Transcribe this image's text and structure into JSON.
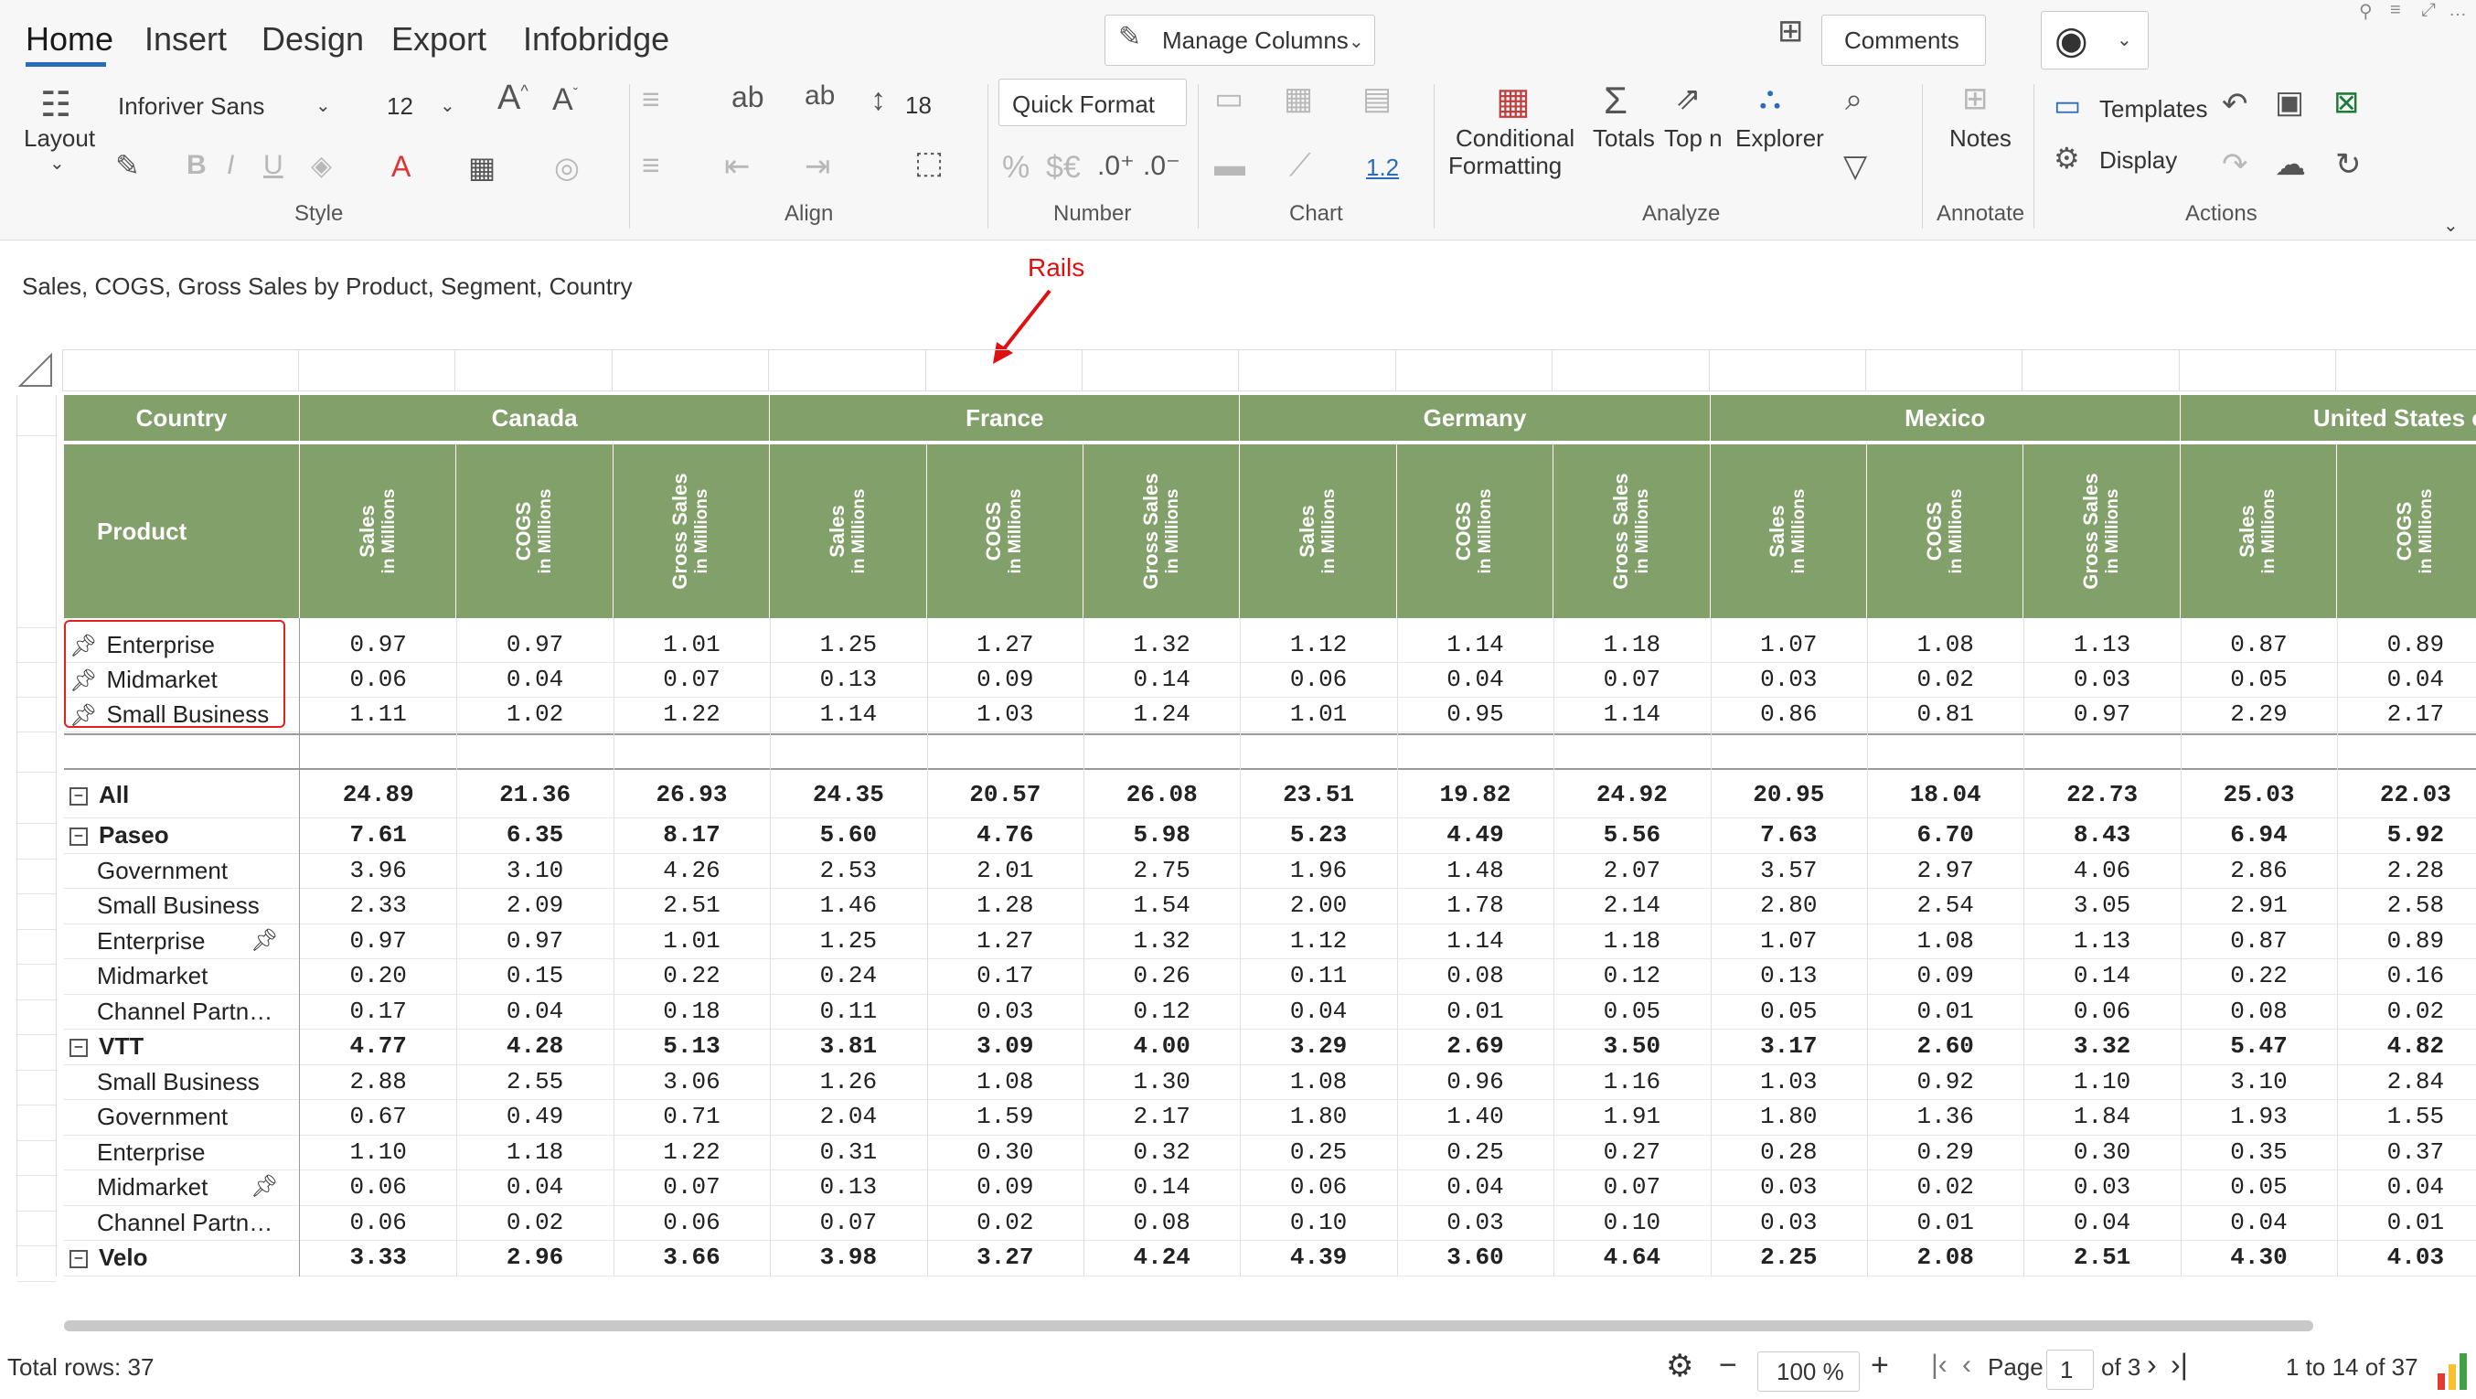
{
  "ribbon": {
    "tabs": [
      "Home",
      "Insert",
      "Design",
      "Export",
      "Infobridge"
    ],
    "manage_columns": "Manage Columns",
    "comments": "Comments",
    "layout_label": "Layout",
    "font_family": "Inforiver Sans",
    "font_size": "12",
    "line_height": "18",
    "quick_format": "Quick Format",
    "chart_number": "1.2",
    "conditional_formatting_1": "Conditional",
    "conditional_formatting_2": "Formatting",
    "totals": "Totals",
    "topn": "Top n",
    "explorer": "Explorer",
    "notes": "Notes",
    "templates": "Templates",
    "display": "Display",
    "groups": {
      "style": "Style",
      "align": "Align",
      "number": "Number",
      "chart": "Chart",
      "analyze": "Analyze",
      "annotate": "Annotate",
      "actions": "Actions"
    }
  },
  "caption": "Sales, COGS, Gross Sales by Product, Segment, Country",
  "rails_label": "Rails",
  "table": {
    "country_header": "Country",
    "product_header": "Product",
    "countries": [
      "Canada",
      "France",
      "Germany",
      "Mexico",
      "United States of A"
    ],
    "measures": [
      {
        "name": "Sales",
        "unit": "in Millions"
      },
      {
        "name": "COGS",
        "unit": "in Millions"
      },
      {
        "name": "Gross Sales",
        "unit": "in Millions"
      }
    ],
    "pinned_rows": [
      {
        "label": "Enterprise",
        "values": [
          "0.97",
          "0.97",
          "1.01",
          "1.25",
          "1.27",
          "1.32",
          "1.12",
          "1.14",
          "1.18",
          "1.07",
          "1.08",
          "1.13",
          "0.87",
          "0.89"
        ]
      },
      {
        "label": "Midmarket",
        "values": [
          "0.06",
          "0.04",
          "0.07",
          "0.13",
          "0.09",
          "0.14",
          "0.06",
          "0.04",
          "0.07",
          "0.03",
          "0.02",
          "0.03",
          "0.05",
          "0.04"
        ]
      },
      {
        "label": "Small Business",
        "values": [
          "1.11",
          "1.02",
          "1.22",
          "1.14",
          "1.03",
          "1.24",
          "1.01",
          "0.95",
          "1.14",
          "0.86",
          "0.81",
          "0.97",
          "2.29",
          "2.17"
        ]
      }
    ],
    "rows": [
      {
        "label": "All",
        "level": 0,
        "bold": true,
        "collapse": true,
        "values": [
          "24.89",
          "21.36",
          "26.93",
          "24.35",
          "20.57",
          "26.08",
          "23.51",
          "19.82",
          "24.92",
          "20.95",
          "18.04",
          "22.73",
          "25.03",
          "22.03"
        ]
      },
      {
        "label": "Paseo",
        "level": 0,
        "bold": true,
        "collapse": true,
        "values": [
          "7.61",
          "6.35",
          "8.17",
          "5.60",
          "4.76",
          "5.98",
          "5.23",
          "4.49",
          "5.56",
          "7.63",
          "6.70",
          "8.43",
          "6.94",
          "5.92"
        ]
      },
      {
        "label": "Government",
        "level": 1,
        "values": [
          "3.96",
          "3.10",
          "4.26",
          "2.53",
          "2.01",
          "2.75",
          "1.96",
          "1.48",
          "2.07",
          "3.57",
          "2.97",
          "4.06",
          "2.86",
          "2.28"
        ]
      },
      {
        "label": "Small Business",
        "level": 1,
        "values": [
          "2.33",
          "2.09",
          "2.51",
          "1.46",
          "1.28",
          "1.54",
          "2.00",
          "1.78",
          "2.14",
          "2.80",
          "2.54",
          "3.05",
          "2.91",
          "2.58"
        ]
      },
      {
        "label": "Enterprise",
        "level": 1,
        "pinned": true,
        "values": [
          "0.97",
          "0.97",
          "1.01",
          "1.25",
          "1.27",
          "1.32",
          "1.12",
          "1.14",
          "1.18",
          "1.07",
          "1.08",
          "1.13",
          "0.87",
          "0.89"
        ]
      },
      {
        "label": "Midmarket",
        "level": 1,
        "values": [
          "0.20",
          "0.15",
          "0.22",
          "0.24",
          "0.17",
          "0.26",
          "0.11",
          "0.08",
          "0.12",
          "0.13",
          "0.09",
          "0.14",
          "0.22",
          "0.16"
        ]
      },
      {
        "label": "Channel Partn…",
        "level": 1,
        "values": [
          "0.17",
          "0.04",
          "0.18",
          "0.11",
          "0.03",
          "0.12",
          "0.04",
          "0.01",
          "0.05",
          "0.05",
          "0.01",
          "0.06",
          "0.08",
          "0.02"
        ]
      },
      {
        "label": "VTT",
        "level": 0,
        "bold": true,
        "collapse": true,
        "values": [
          "4.77",
          "4.28",
          "5.13",
          "3.81",
          "3.09",
          "4.00",
          "3.29",
          "2.69",
          "3.50",
          "3.17",
          "2.60",
          "3.32",
          "5.47",
          "4.82"
        ]
      },
      {
        "label": "Small Business",
        "level": 1,
        "values": [
          "2.88",
          "2.55",
          "3.06",
          "1.26",
          "1.08",
          "1.30",
          "1.08",
          "0.96",
          "1.16",
          "1.03",
          "0.92",
          "1.10",
          "3.10",
          "2.84"
        ]
      },
      {
        "label": "Government",
        "level": 1,
        "values": [
          "0.67",
          "0.49",
          "0.71",
          "2.04",
          "1.59",
          "2.17",
          "1.80",
          "1.40",
          "1.91",
          "1.80",
          "1.36",
          "1.84",
          "1.93",
          "1.55"
        ]
      },
      {
        "label": "Enterprise",
        "level": 1,
        "values": [
          "1.10",
          "1.18",
          "1.22",
          "0.31",
          "0.30",
          "0.32",
          "0.25",
          "0.25",
          "0.27",
          "0.28",
          "0.29",
          "0.30",
          "0.35",
          "0.37"
        ]
      },
      {
        "label": "Midmarket",
        "level": 1,
        "pinned": true,
        "values": [
          "0.06",
          "0.04",
          "0.07",
          "0.13",
          "0.09",
          "0.14",
          "0.06",
          "0.04",
          "0.07",
          "0.03",
          "0.02",
          "0.03",
          "0.05",
          "0.04"
        ]
      },
      {
        "label": "Channel Partn…",
        "level": 1,
        "values": [
          "0.06",
          "0.02",
          "0.06",
          "0.07",
          "0.02",
          "0.08",
          "0.10",
          "0.03",
          "0.10",
          "0.03",
          "0.01",
          "0.04",
          "0.04",
          "0.01"
        ]
      },
      {
        "label": "Velo",
        "level": 0,
        "bold": true,
        "collapse": true,
        "values": [
          "3.33",
          "2.96",
          "3.66",
          "3.98",
          "3.27",
          "4.24",
          "4.39",
          "3.60",
          "4.64",
          "2.25",
          "2.08",
          "2.51",
          "4.30",
          "4.03"
        ]
      }
    ]
  },
  "footer": {
    "total_rows": "Total rows: 37",
    "zoom": "100 %",
    "page_label": "Page",
    "page_value": "1",
    "page_of": "of 3",
    "range": "1 to 14 of 37"
  },
  "colors": {
    "header_green": "#82a06a",
    "accent_blue": "#2b6cb8",
    "rails_red": "#e01010"
  }
}
